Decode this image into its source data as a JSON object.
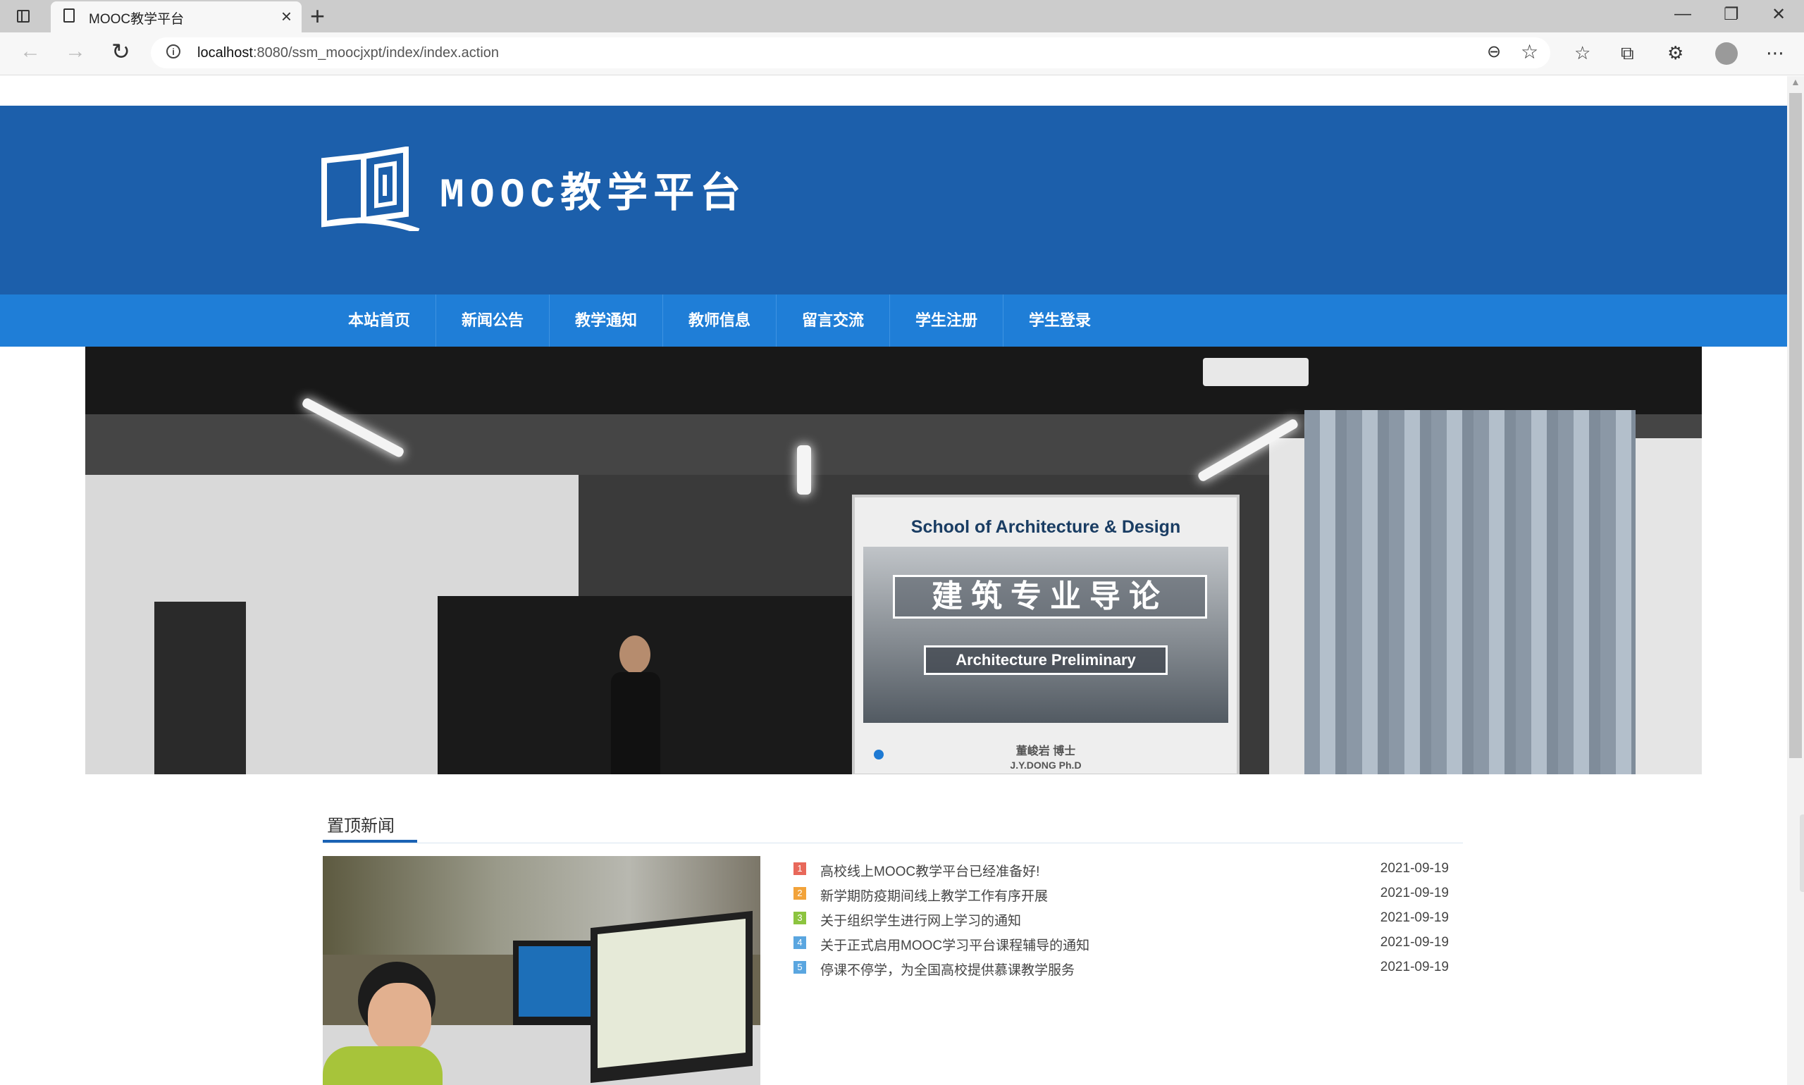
{
  "browser": {
    "tab_title": "MOOC教学平台",
    "url_host": "localhost",
    "url_rest": ":8080/ssm_moocjxpt/index/index.action"
  },
  "site": {
    "title": "MOOC教学平台",
    "brand_color": "#1c5fab",
    "nav_color": "#1f7ed7"
  },
  "nav": {
    "items": [
      "本站首页",
      "新闻公告",
      "教学通知",
      "教师信息",
      "留言交流",
      "学生注册",
      "学生登录"
    ]
  },
  "banner": {
    "school": "School of Architecture & Design",
    "course_cn": "建筑专业导论",
    "course_en": "Architecture Preliminary",
    "lecturer": "董峻岩    博士",
    "lecturer_en": "J.Y.DONG      Ph.D"
  },
  "news": {
    "heading": "置顶新闻",
    "items": [
      {
        "num": "1",
        "title": "高校线上MOOC教学平台已经准备好!",
        "date": "2021-09-19",
        "color": "#e8685a"
      },
      {
        "num": "2",
        "title": "新学期防疫期间线上教学工作有序开展",
        "date": "2021-09-19",
        "color": "#f2a33a"
      },
      {
        "num": "3",
        "title": "关于组织学生进行网上学习的通知",
        "date": "2021-09-19",
        "color": "#8cc43f"
      },
      {
        "num": "4",
        "title": "关于正式启用MOOC学习平台课程辅导的通知",
        "date": "2021-09-19",
        "color": "#5aa6e0"
      },
      {
        "num": "5",
        "title": "停课不停学，为全国高校提供慕课教学服务",
        "date": "2021-09-19",
        "color": "#5aa6e0"
      }
    ]
  }
}
